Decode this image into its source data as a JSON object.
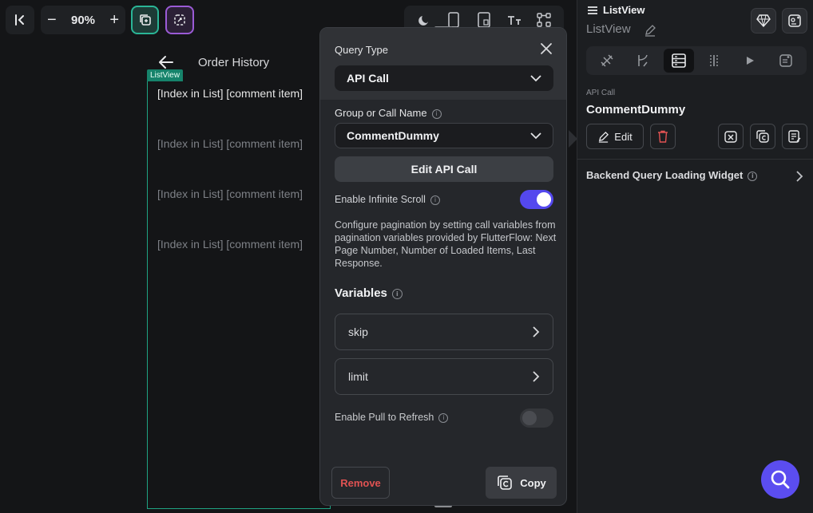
{
  "toolbar": {
    "zoom_label": "90%",
    "zoom_minus": "−",
    "zoom_plus": "+"
  },
  "canvas": {
    "page_title": "Order History",
    "listview_tag": "ListView",
    "items": [
      "[Index in List] [comment item]",
      "[Index in List] [comment item]",
      "[Index in List] [comment item]",
      "[Index in List] [comment item]"
    ]
  },
  "query_panel": {
    "query_type_label": "Query Type",
    "query_type_value": "API Call",
    "group_label": "Group or Call Name",
    "group_value": "CommentDummy",
    "edit_api_call": "Edit API Call",
    "infinite_scroll_label": "Enable Infinite Scroll",
    "infinite_scroll_on": true,
    "description": "Configure pagination by setting call variables from pagination variables provided by FlutterFlow: Next Page Number, Number of Loaded Items, Last Response.",
    "variables_title": "Variables",
    "variables": [
      "skip",
      "limit"
    ],
    "pull_refresh_label": "Enable Pull to Refresh",
    "pull_refresh_on": false,
    "remove_label": "Remove",
    "copy_label": "Copy"
  },
  "properties": {
    "widget_type": "ListView",
    "widget_name": "ListView",
    "query_kind": "API Call",
    "call_name": "CommentDummy",
    "edit_label": "Edit",
    "backend_loading_label": "Backend Query Loading Widget"
  },
  "colors": {
    "accent": "#5b4df0",
    "toggle_on": "#5448ee",
    "listview_border": "#1fa383",
    "remove_text": "#e05252"
  }
}
